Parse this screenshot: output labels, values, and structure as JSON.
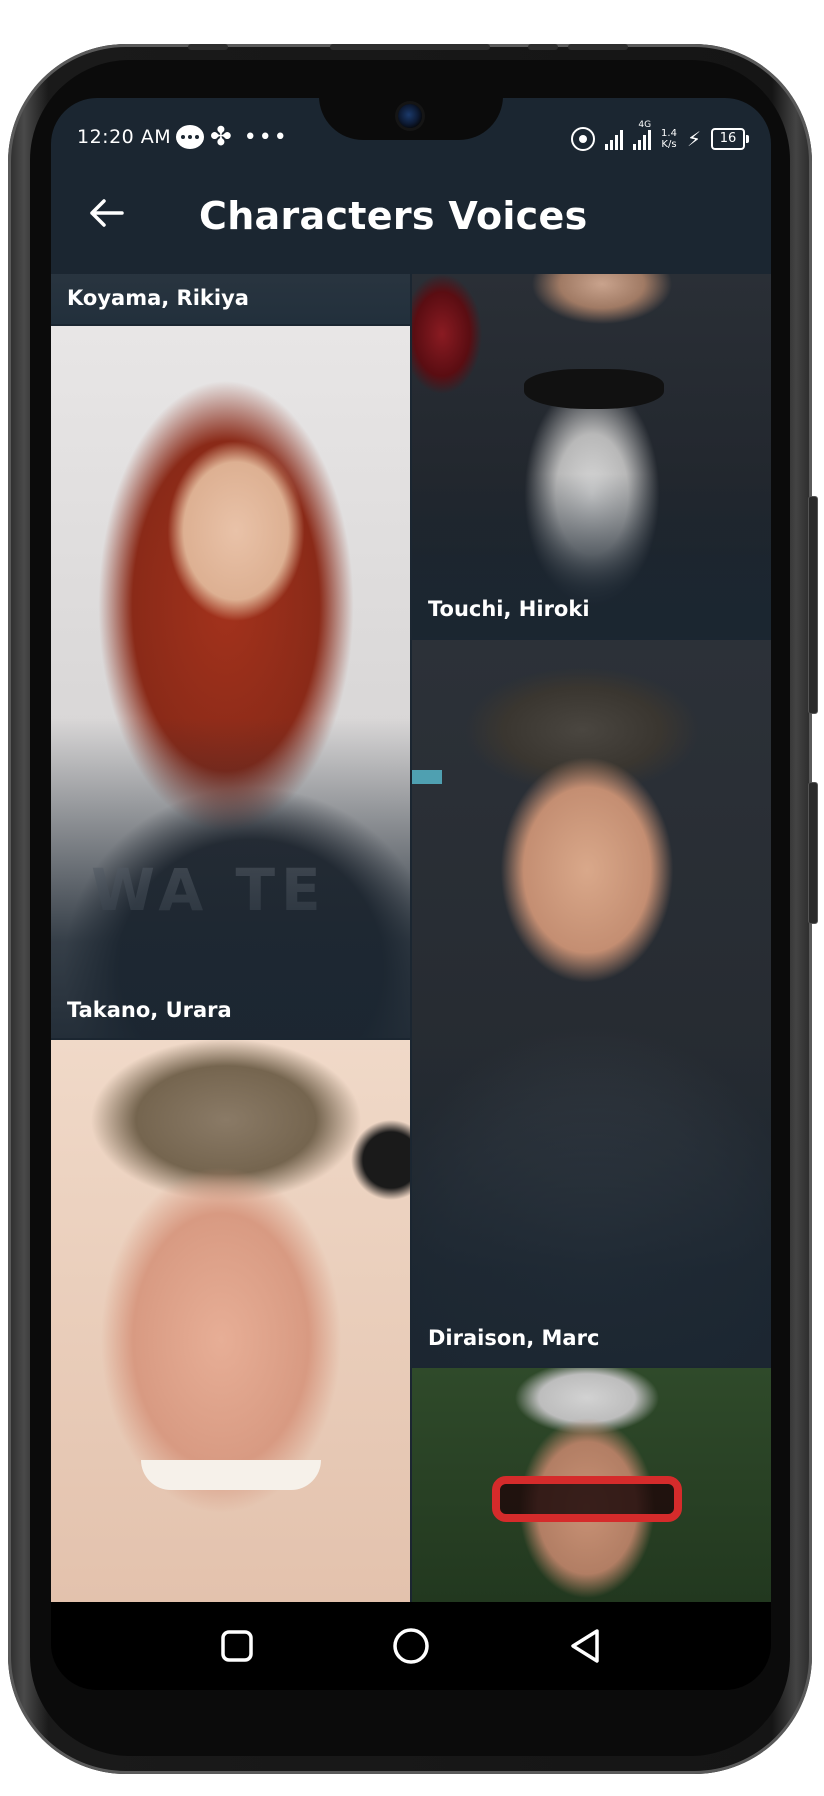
{
  "status_bar": {
    "time": "12:20 AM",
    "network_label": "4G",
    "speed_value": "1.4",
    "speed_unit": "K/s",
    "battery": "16",
    "icons": [
      "message-icon",
      "pinwheel-icon",
      "more-dots-icon",
      "hotspot-icon",
      "signal-icon",
      "charging-icon",
      "battery-icon"
    ]
  },
  "app_bar": {
    "title": "Characters Voices",
    "back_icon": "arrow-left-icon"
  },
  "voice_actors": [
    {
      "name": "Koyama, Rikiya"
    },
    {
      "name": "Touchi, Hiroki"
    },
    {
      "name": "Takano, Urara"
    },
    {
      "name": "Diraison, Marc"
    },
    {
      "name": ""
    },
    {
      "name": ""
    }
  ],
  "nav_bar": {
    "buttons": [
      "recents-square-icon",
      "home-circle-icon",
      "back-triangle-icon"
    ]
  },
  "colors": {
    "app_background": "#1b2631",
    "text": "#ffffff",
    "nav_background": "#000000"
  }
}
